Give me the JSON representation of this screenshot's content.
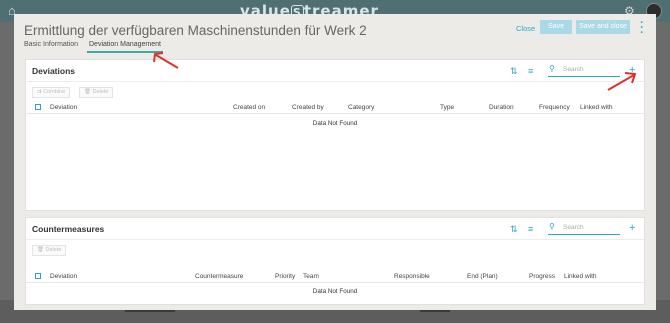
{
  "app": {
    "brand": "valueStreamer",
    "brand_value": "value",
    "brand_rest": "treamer"
  },
  "modal": {
    "title": "Ermittlung der verfügbaren Maschinenstunden für Werk 2",
    "close_label": "Close",
    "save_label": "Save",
    "save_close_label": "Save and close",
    "tabs": [
      {
        "label": "Basic Information",
        "active": false
      },
      {
        "label": "Deviation Management",
        "active": true
      }
    ]
  },
  "deviations": {
    "title": "Deviations",
    "search_placeholder": "Search",
    "buttons": {
      "combine": "Combine",
      "delete": "Delete"
    },
    "columns": [
      "Deviation",
      "Created on",
      "Created by",
      "Category",
      "Type",
      "Duration",
      "Frequency",
      "Linked with"
    ],
    "empty_text": "Data Not Found"
  },
  "countermeasures": {
    "title": "Countermeasures",
    "search_placeholder": "Search",
    "buttons": {
      "delete": "Delete"
    },
    "columns": [
      "Deviation",
      "Countermeasure",
      "Priority",
      "Team",
      "Responsible",
      "End (Plan)",
      "Progress",
      "Linked with"
    ],
    "empty_text": "Data Not Found"
  },
  "colors": {
    "accent": "#2aa6c4",
    "tab_underline": "#3aa9a6",
    "annotation_arrow": "#d9342b",
    "button_disabled": "#a9d8e6"
  },
  "icons": [
    "home-icon",
    "gear-icon",
    "kebab-menu-icon",
    "sort-icon",
    "filter-icon",
    "search-icon",
    "plus-icon",
    "combine-icon",
    "trash-icon"
  ]
}
